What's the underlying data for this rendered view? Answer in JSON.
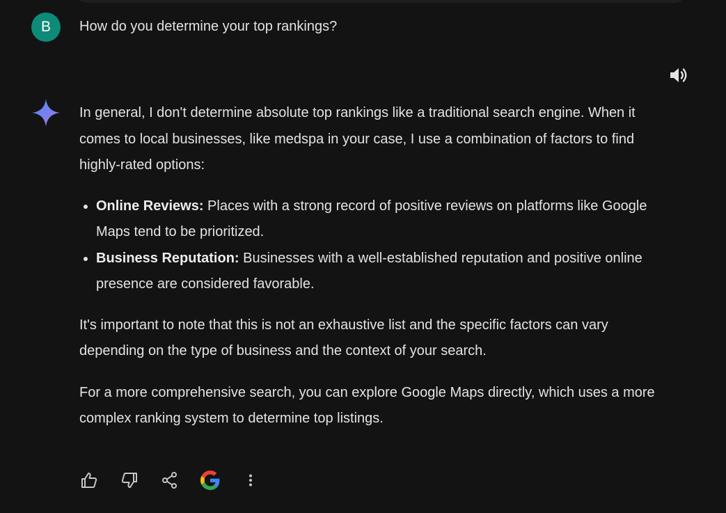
{
  "user": {
    "avatar_letter": "B",
    "query": "How do you determine your top rankings?"
  },
  "response": {
    "intro": "In general, I don't determine absolute top rankings like a traditional search engine. When it comes to local businesses, like medspa in your case, I use a combination of factors to find highly-rated options:",
    "bullets": [
      {
        "title": "Online Reviews:",
        "text": " Places with a strong record of positive reviews on platforms like Google Maps tend to be prioritized."
      },
      {
        "title": "Business Reputation:",
        "text": " Businesses with a well-established reputation and positive online presence are considered favorable."
      }
    ],
    "note": "It's important to note that this is not an exhaustive list and the specific factors can vary depending on the type of business and the context of your search.",
    "closing": "For a more comprehensive search, you can explore Google Maps directly, which uses a more complex ranking system to determine top listings."
  },
  "icons": {
    "speaker": "speaker-icon",
    "sparkle": "gemini-sparkle-icon",
    "actions": [
      "thumbs-up-icon",
      "thumbs-down-icon",
      "share-icon",
      "google-g-icon",
      "more-vertical-icon"
    ]
  },
  "colors": {
    "background": "#131314",
    "text": "#e3e3e3",
    "avatar": "#0e8a78",
    "icon": "#c4c7c5"
  }
}
